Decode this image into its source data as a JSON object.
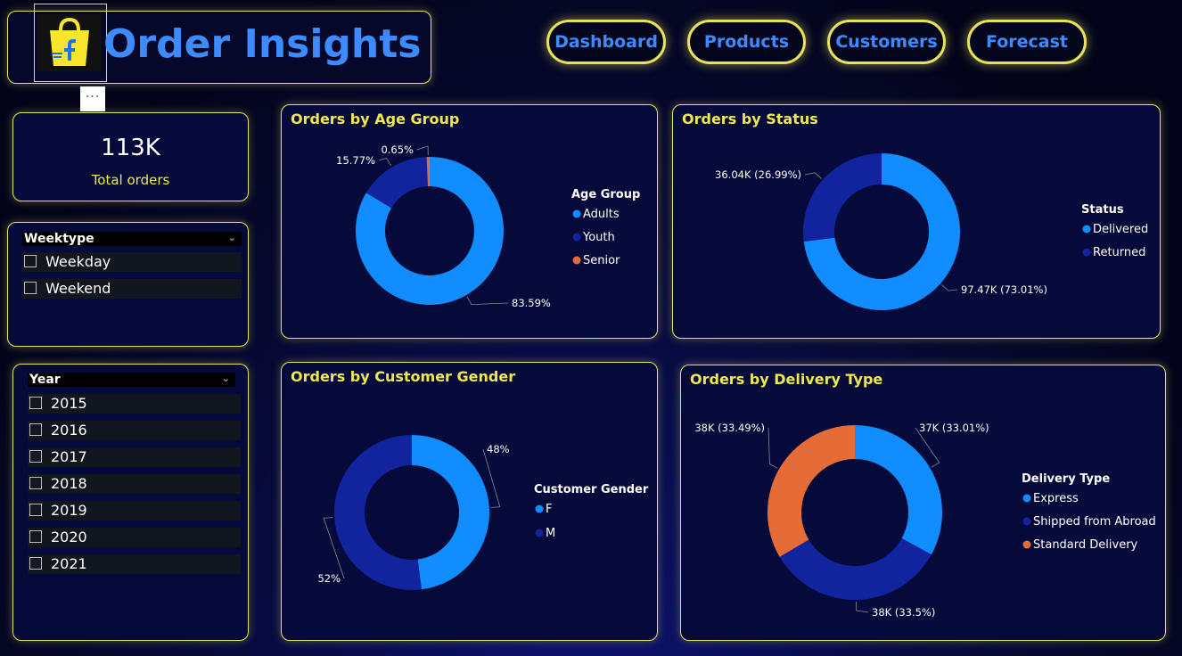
{
  "header": {
    "title": "Order Insights",
    "more_label": "···"
  },
  "nav": [
    {
      "label": "Dashboard"
    },
    {
      "label": "Products"
    },
    {
      "label": "Customers"
    },
    {
      "label": "Forecast"
    }
  ],
  "kpi": {
    "value": "113K",
    "label": "Total orders"
  },
  "weektype_slicer": {
    "title": "Weektype",
    "options": [
      "Weekday",
      "Weekend"
    ]
  },
  "year_slicer": {
    "title": "Year",
    "options": [
      "2015",
      "2016",
      "2017",
      "2018",
      "2019",
      "2020",
      "2021"
    ]
  },
  "colors": {
    "accent_yellow": "#e6e35a",
    "title_blue": "#3d8bff",
    "light_blue": "#118dff",
    "dark_blue": "#12239e",
    "orange": "#e66c37"
  },
  "chart_data": [
    {
      "type": "pie",
      "title": "Orders by Age Group",
      "legend_title": "Age Group",
      "categories": [
        "Adults",
        "Youth",
        "Senior"
      ],
      "values": [
        83.59,
        15.77,
        0.65
      ],
      "labels": [
        "83.59%",
        "15.77%",
        "0.65%"
      ],
      "colors": [
        "#118dff",
        "#12239e",
        "#e66c37"
      ],
      "legend": "right"
    },
    {
      "type": "pie",
      "title": "Orders by Status",
      "legend_title": "Status",
      "categories": [
        "Delivered",
        "Returned"
      ],
      "values": [
        97.47,
        36.04
      ],
      "labels": [
        "97.47K (73.01%)",
        "36.04K (26.99%)"
      ],
      "colors": [
        "#118dff",
        "#12239e"
      ],
      "legend": "right"
    },
    {
      "type": "pie",
      "title": "Orders by Customer Gender",
      "legend_title": "Customer Gender",
      "categories": [
        "F",
        "M"
      ],
      "values": [
        48,
        52
      ],
      "labels": [
        "48%",
        "52%"
      ],
      "colors": [
        "#118dff",
        "#12239e"
      ],
      "legend": "right"
    },
    {
      "type": "pie",
      "title": "Orders by Delivery Type",
      "legend_title": "Delivery Type",
      "categories": [
        "Express",
        "Shipped from Abroad",
        "Standard Delivery"
      ],
      "values": [
        33.01,
        33.5,
        33.49
      ],
      "labels": [
        "37K (33.01%)",
        "38K (33.5%)",
        "38K (33.49%)"
      ],
      "colors": [
        "#118dff",
        "#12239e",
        "#e66c37"
      ],
      "legend": "right"
    }
  ]
}
